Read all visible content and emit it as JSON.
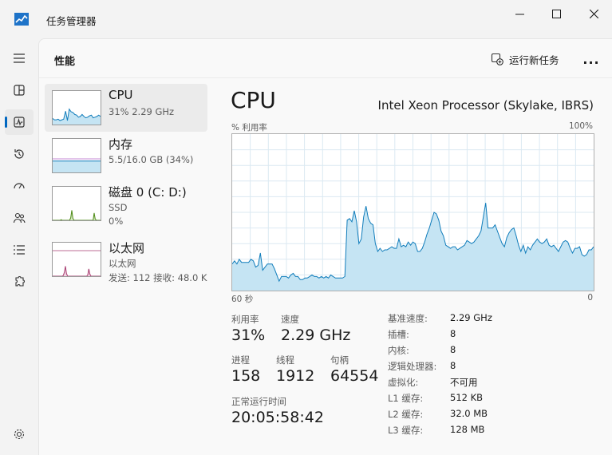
{
  "window": {
    "title": "任务管理器"
  },
  "header": {
    "page_title": "性能",
    "run_new_task": "运行新任务",
    "more": "..."
  },
  "rail": [
    "hamburger-icon",
    "processes-icon",
    "performance-icon",
    "history-icon",
    "startup-icon",
    "users-icon",
    "details-icon",
    "services-icon",
    "settings-icon"
  ],
  "items": {
    "cpu": {
      "name": "CPU",
      "sub": "31%  2.29 GHz"
    },
    "mem": {
      "name": "内存",
      "sub": "5.5/16.0 GB (34%)"
    },
    "disk": {
      "name": "磁盘 0 (C: D:)",
      "sub1": "SSD",
      "sub2": "0%"
    },
    "net": {
      "name": "以太网",
      "sub1": "以太网",
      "sub2": "发送: 112 接收: 48.0 K"
    }
  },
  "detail": {
    "title": "CPU",
    "model": "Intel Xeon Processor (Skylake, IBRS)",
    "util_label": "% 利用率",
    "max_label": "100%",
    "time_label": "60 秒",
    "zero_label": "0",
    "stats": {
      "util_label": "利用率",
      "util_value": "31%",
      "speed_label": "速度",
      "speed_value": "2.29 GHz",
      "proc_label": "进程",
      "proc_value": "158",
      "thread_label": "线程",
      "thread_value": "1912",
      "handle_label": "句柄",
      "handle_value": "64554",
      "uptime_label": "正常运行时间",
      "uptime_value": "20:05:58:42"
    },
    "specs": [
      {
        "k": "基准速度:",
        "v": "2.29 GHz"
      },
      {
        "k": "插槽:",
        "v": "8"
      },
      {
        "k": "内核:",
        "v": "8"
      },
      {
        "k": "逻辑处理器:",
        "v": "8"
      },
      {
        "k": "虚拟化:",
        "v": "不可用"
      },
      {
        "k": "L1 缓存:",
        "v": "512 KB"
      },
      {
        "k": "L2 缓存:",
        "v": "32.0 MB"
      },
      {
        "k": "L3 缓存:",
        "v": "128 MB"
      }
    ]
  },
  "chart_data": {
    "type": "area",
    "ylabel": "% 利用率",
    "ylim": [
      0,
      100
    ],
    "x_range_seconds": [
      60,
      0
    ],
    "grid": true,
    "values": [
      17,
      19,
      17,
      20,
      18,
      18,
      18,
      18,
      20,
      19,
      15,
      16,
      24,
      13,
      15,
      17,
      17,
      17,
      14,
      10,
      6,
      9,
      9,
      9,
      8,
      10,
      11,
      9,
      9,
      7,
      7,
      8,
      8,
      9,
      10,
      9,
      9,
      8,
      9,
      8,
      9,
      8,
      10,
      9,
      8,
      8,
      8,
      8,
      9,
      45,
      46,
      44,
      51,
      44,
      30,
      33,
      47,
      54,
      46,
      43,
      42,
      30,
      25,
      27,
      25,
      26,
      26,
      27,
      28,
      27,
      27,
      33,
      28,
      29,
      28,
      31,
      29,
      31,
      30,
      25,
      25,
      27,
      31,
      36,
      40,
      45,
      50,
      49,
      45,
      38,
      35,
      29,
      28,
      27,
      28,
      28,
      26,
      27,
      28,
      29,
      32,
      31,
      30,
      31,
      33,
      35,
      38,
      47,
      56,
      40,
      40,
      40,
      42,
      38,
      34,
      30,
      28,
      34,
      37,
      39,
      40,
      35,
      29,
      25,
      29,
      24,
      28,
      26,
      29,
      31,
      33,
      31,
      30,
      31,
      33,
      29,
      28,
      29,
      27,
      25,
      28,
      31,
      32,
      31,
      27,
      24,
      27,
      27,
      28,
      23,
      22,
      23,
      26,
      26,
      28
    ]
  },
  "thumbs": {
    "cpu": [
      18,
      14,
      14,
      16,
      12,
      14,
      16,
      40,
      12,
      46,
      38,
      36,
      30,
      28,
      22,
      24,
      30,
      24,
      20,
      22,
      26,
      28,
      20,
      22,
      24,
      28,
      24
    ],
    "mem": [
      34,
      34,
      34,
      34,
      34,
      34,
      34,
      34,
      34,
      34,
      34,
      34,
      34,
      34,
      34,
      34,
      34,
      34,
      34,
      34
    ],
    "disk": [
      0,
      0,
      0,
      0,
      0,
      0,
      0,
      0,
      2,
      0,
      0,
      0,
      0,
      0,
      0,
      0,
      0,
      8,
      30,
      6,
      0,
      0,
      0,
      0,
      0,
      0,
      0,
      0,
      0,
      0,
      0,
      0,
      0,
      0,
      0,
      0,
      0,
      0,
      0,
      22,
      4,
      0,
      0,
      0,
      0,
      0
    ],
    "net": [
      0,
      0,
      0,
      0,
      0,
      0,
      0,
      0,
      0,
      0,
      2,
      12,
      30,
      8,
      0,
      0,
      0,
      0,
      0,
      0,
      0,
      0,
      0,
      0,
      0,
      0,
      0,
      0,
      0,
      0,
      0,
      0,
      0,
      4,
      22,
      6,
      0,
      0,
      0,
      0,
      0,
      0,
      0,
      0,
      0,
      0
    ]
  },
  "colors": {
    "cpu_line": "#117dbb",
    "cpu_fill": "#c5e4f3",
    "mem_line": "#8b12ae",
    "disk_line": "#4d8a15",
    "net_line": "#a73c70",
    "accent": "#0067c0"
  }
}
